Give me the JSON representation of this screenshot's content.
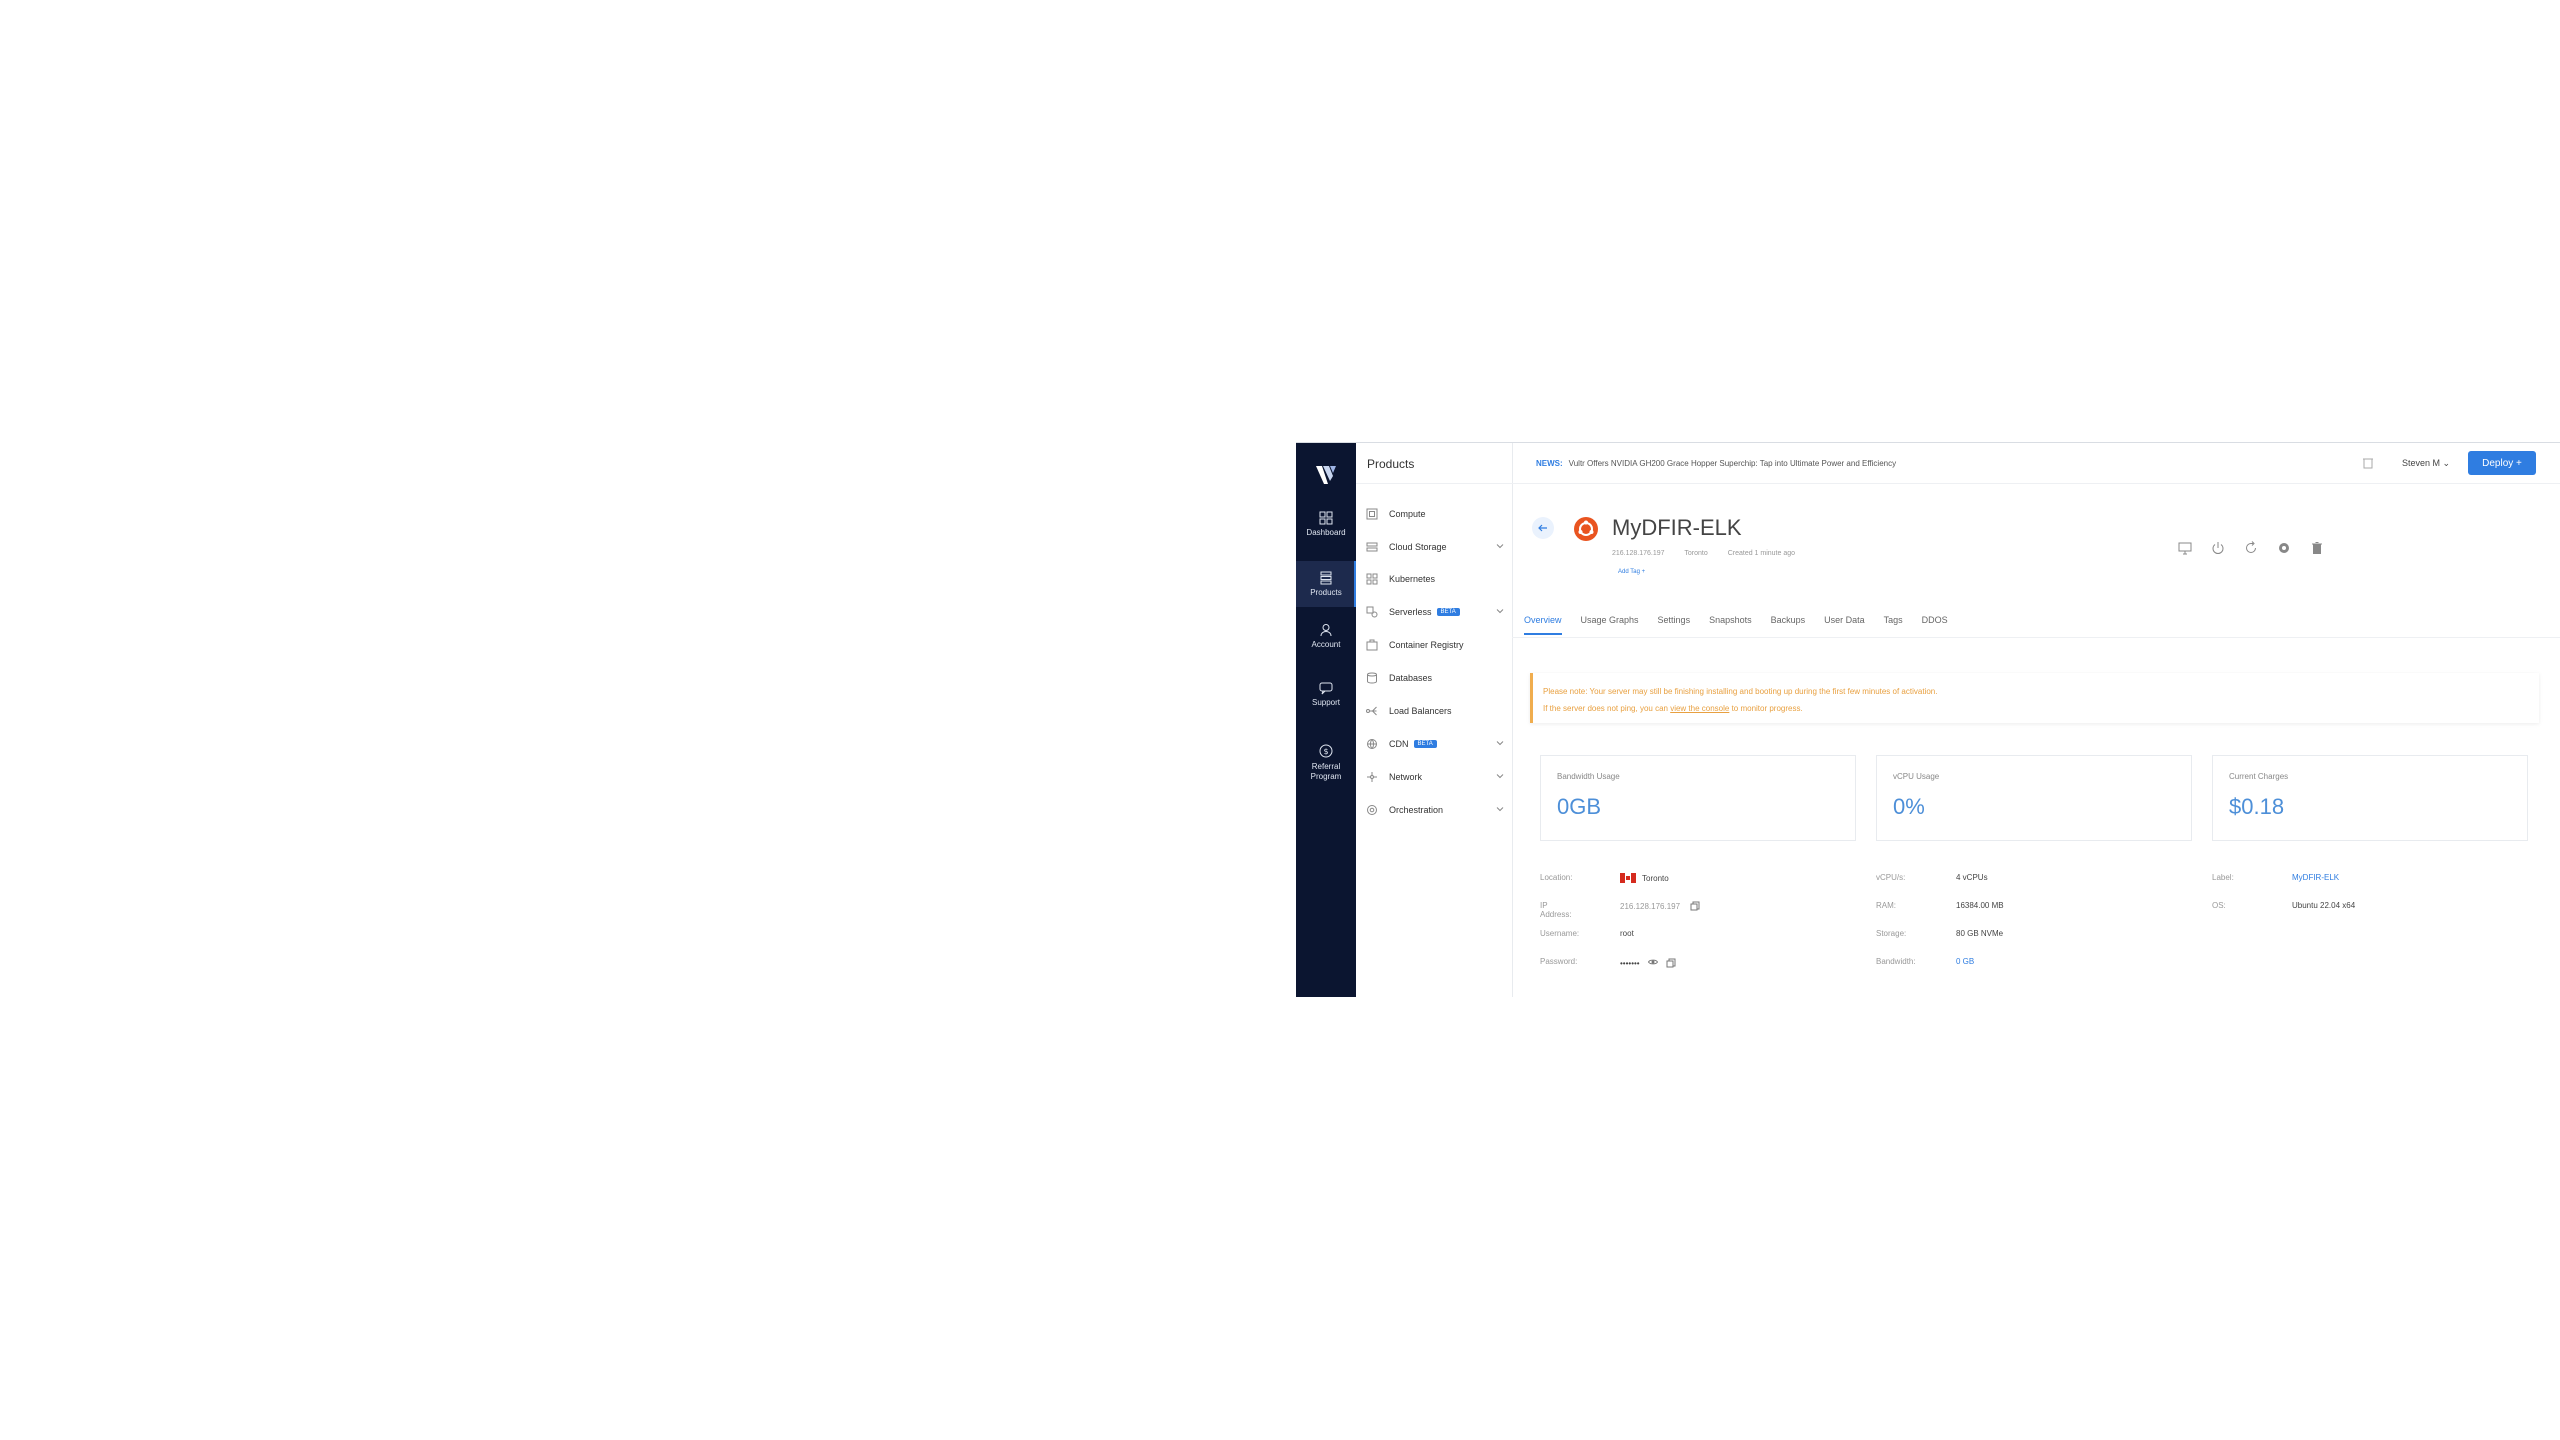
{
  "rail": {
    "items": [
      {
        "label": "Dashboard"
      },
      {
        "label": "Products"
      },
      {
        "label": "Account"
      },
      {
        "label": "Support"
      },
      {
        "label": "Referral",
        "label2": "Program"
      }
    ]
  },
  "products": {
    "title": "Products",
    "items": [
      {
        "label": "Compute"
      },
      {
        "label": "Cloud Storage"
      },
      {
        "label": "Kubernetes"
      },
      {
        "label": "Serverless",
        "badge": "BETA"
      },
      {
        "label": "Container Registry"
      },
      {
        "label": "Databases"
      },
      {
        "label": "Load Balancers"
      },
      {
        "label": "CDN",
        "badge": "BETA"
      },
      {
        "label": "Network"
      },
      {
        "label": "Orchestration"
      }
    ]
  },
  "topbar": {
    "news_label": "NEWS:",
    "news_text": "Vultr Offers NVIDIA GH200 Grace Hopper Superchip: Tap into Ultimate Power and Efficiency",
    "user": "Steven M",
    "deploy_label": "Deploy +"
  },
  "server": {
    "name": "MyDFIR-ELK",
    "ip": "216.128.176.197",
    "location": "Toronto",
    "created": "Created 1 minute ago",
    "add_tag": "Add Tag +"
  },
  "tabs": [
    "Overview",
    "Usage Graphs",
    "Settings",
    "Snapshots",
    "Backups",
    "User Data",
    "Tags",
    "DDOS"
  ],
  "notice": {
    "line1": "Please note: Your server may still be finishing installing and booting up during the first few minutes of activation.",
    "line2_a": "If the server does not ping, you can ",
    "line2_link": "view the console",
    "line2_b": " to monitor progress."
  },
  "cards": [
    {
      "label": "Bandwidth Usage",
      "value": "0GB"
    },
    {
      "label": "vCPU Usage",
      "value": "0%"
    },
    {
      "label": "Current Charges",
      "value": "$0.18"
    }
  ],
  "info": {
    "location_k": "Location:",
    "location_v": "Toronto",
    "ip_k": "IP Address:",
    "ip_v": "216.128.176.197",
    "user_k": "Username:",
    "user_v": "root",
    "pass_k": "Password:",
    "pass_v": "•••••••",
    "vcpu_k": "vCPU/s:",
    "vcpu_v": "4 vCPUs",
    "ram_k": "RAM:",
    "ram_v": "16384.00 MB",
    "storage_k": "Storage:",
    "storage_v": "80 GB NVMe",
    "bw_k": "Bandwidth:",
    "bw_v": "0 GB",
    "label_k": "Label:",
    "label_v": "MyDFIR-ELK",
    "os_k": "OS:",
    "os_v": "Ubuntu 22.04 x64"
  },
  "colors": {
    "accent": "#2f7de1",
    "rail": "#0b1530",
    "warning": "#f0ad4e",
    "ubuntu": "#e95420"
  }
}
